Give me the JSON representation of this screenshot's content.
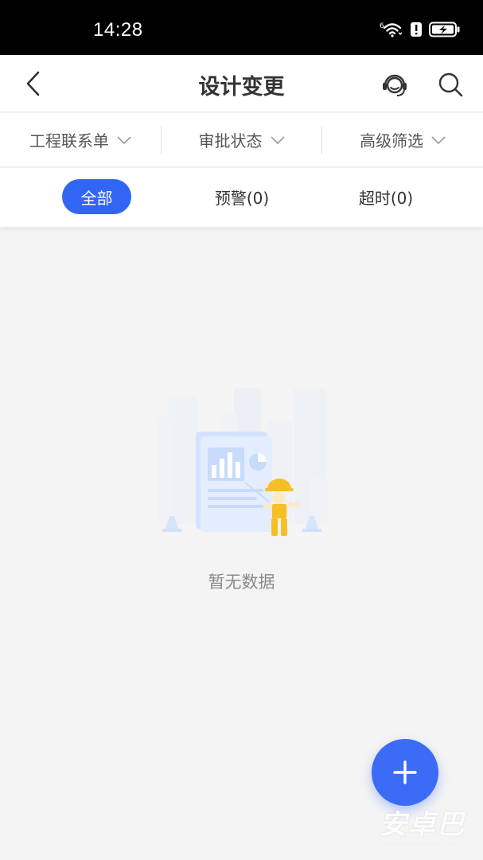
{
  "status_bar": {
    "time": "14:28",
    "wifi_badge": "6",
    "icons": [
      "wifi-icon",
      "alert-icon",
      "battery-charging-icon"
    ]
  },
  "app_bar": {
    "title": "设计变更",
    "icons": [
      "back-arrow-icon",
      "customer-service-icon",
      "search-icon"
    ]
  },
  "filters": [
    {
      "label": "工程联系单",
      "icon": "chevron-down-icon"
    },
    {
      "label": "审批状态",
      "icon": "chevron-down-icon"
    },
    {
      "label": "高级筛选",
      "icon": "chevron-down-icon"
    }
  ],
  "tabs": [
    {
      "label": "全部",
      "active": true
    },
    {
      "label": "预警(0)",
      "active": false
    },
    {
      "label": "超时(0)",
      "active": false
    }
  ],
  "empty_state": {
    "illustration": "empty-data-illustration",
    "message": "暂无数据"
  },
  "fab": {
    "icon": "plus-icon"
  },
  "watermark": {
    "title": "安卓巴",
    "subtitle": "www.anzhuo8.com"
  },
  "colors": {
    "accent": "#3166f5",
    "fab": "#3c6cf5",
    "background": "#f4f4f4",
    "title_text": "#333333",
    "muted_text": "#8a8a8a"
  }
}
